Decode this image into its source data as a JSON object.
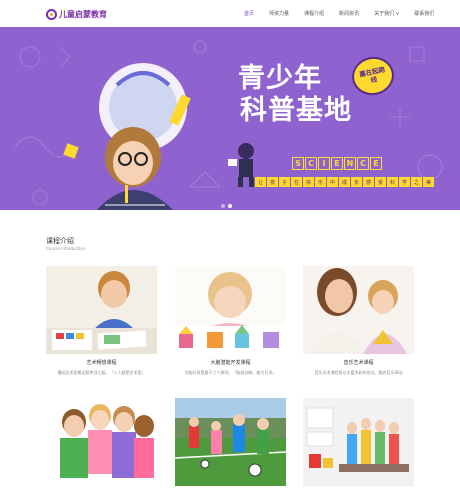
{
  "header": {
    "logo_text": "儿童启蒙教育",
    "nav": [
      {
        "label": "首页",
        "active": true
      },
      {
        "label": "师资力量",
        "active": false
      },
      {
        "label": "课程介绍",
        "active": false
      },
      {
        "label": "新闻资讯",
        "active": false
      },
      {
        "label": "关于我们 ∨",
        "active": false
      },
      {
        "label": "联系我们",
        "active": false
      }
    ]
  },
  "banner": {
    "headline_line1": "青少年",
    "headline_line2": "科普基地",
    "badge": "嘉在起跑线",
    "science_letters": [
      "S",
      "C",
      "I",
      "E",
      "N",
      "C",
      "E"
    ],
    "subline_chars": [
      "让",
      "孩",
      "子",
      "在",
      "快",
      "乐",
      "中",
      "成",
      "长",
      "感",
      "受",
      "科",
      "学",
      "之",
      "美"
    ],
    "slides": 2,
    "active_slide": 1
  },
  "section": {
    "title": "课程介绍",
    "subtitle": "Course introduction"
  },
  "courses": [
    {
      "title": "艺术畅想课程",
      "desc": "播因艺术家搬运帮绝顶之级，「人人都是艺术家」"
    },
    {
      "title": "大脑潜能开发课程",
      "desc": "全脑开发是基于三个原则，「脑部训练、能力开发」"
    },
    {
      "title": "音乐艺术课程",
      "desc": "音乐艺术课程将以丰富多彩的形式、融合音乐律动"
    }
  ],
  "colors": {
    "brand": "#7b2ea8",
    "banner_bg": "#8f63cf",
    "accent_yellow": "#ffd92e"
  }
}
